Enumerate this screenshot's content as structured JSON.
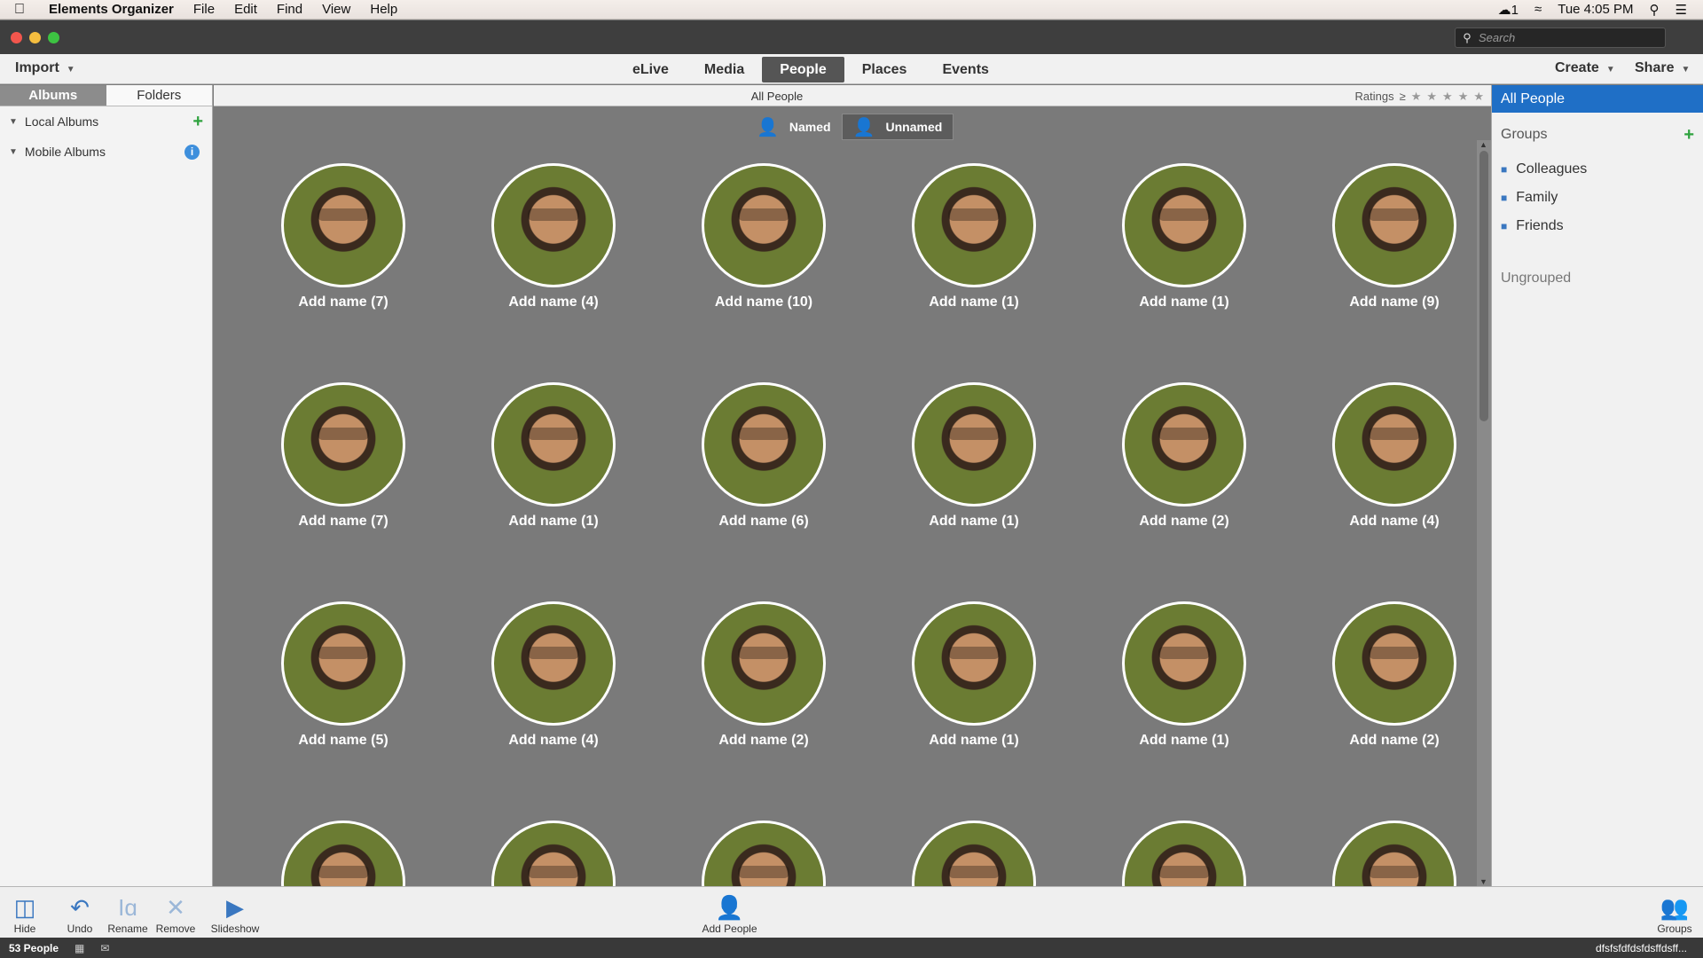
{
  "menubar": {
    "apple": "",
    "app": "Elements Organizer",
    "items": [
      "File",
      "Edit",
      "Find",
      "View",
      "Help"
    ],
    "status_count": "1",
    "clock": "Tue 4:05 PM"
  },
  "titlebar": {
    "search_placeholder": "Search"
  },
  "toolbar": {
    "import": "Import",
    "tabs": [
      "eLive",
      "Media",
      "People",
      "Places",
      "Events"
    ],
    "active_tab": "People",
    "create": "Create",
    "share": "Share"
  },
  "left": {
    "tabs": [
      "Albums",
      "Folders"
    ],
    "local_albums": "Local Albums",
    "mobile_albums": "Mobile Albums"
  },
  "center": {
    "title": "All People",
    "ratings": "Ratings",
    "named": "Named",
    "unnamed": "Unnamed",
    "people": [
      "Add name (7)",
      "Add name (4)",
      "Add name (10)",
      "Add name (1)",
      "Add name (1)",
      "Add name (9)",
      "Add name (7)",
      "Add name (1)",
      "Add name (6)",
      "Add name (1)",
      "Add name (2)",
      "Add name (4)",
      "Add name (5)",
      "Add name (4)",
      "Add name (2)",
      "Add name (1)",
      "Add name (1)",
      "Add name (2)",
      "",
      "",
      "",
      "",
      "",
      ""
    ]
  },
  "right": {
    "all_people": "All People",
    "groups": "Groups",
    "items": [
      "Colleagues",
      "Family",
      "Friends"
    ],
    "ungrouped": "Ungrouped"
  },
  "bottom": {
    "hide": "Hide",
    "undo": "Undo",
    "rename": "Rename",
    "remove": "Remove",
    "slideshow": "Slideshow",
    "add_people": "Add People",
    "groups": "Groups"
  },
  "status": {
    "count": "53 People",
    "trail": "dfsfsfdfdsfdsffdsff..."
  }
}
